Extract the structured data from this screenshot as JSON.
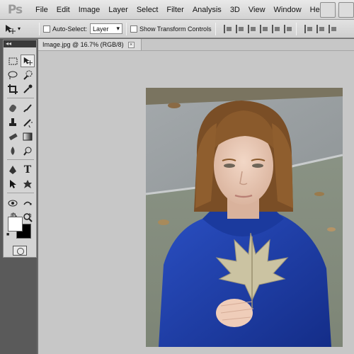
{
  "app": {
    "logo": "Ps"
  },
  "menu": {
    "items": [
      "File",
      "Edit",
      "Image",
      "Layer",
      "Select",
      "Filter",
      "Analysis",
      "3D",
      "View",
      "Window",
      "Help"
    ]
  },
  "options": {
    "auto_select_label": "Auto-Select:",
    "auto_select_value": "Layer",
    "transform_label": "Show Transform Controls"
  },
  "document": {
    "tab_title": "Image.jpg @ 16.7% (RGB/8)",
    "close_glyph": "×"
  },
  "toolbox": {
    "header": "◂◂",
    "foreground_color": "#ffffff",
    "background_color": "#000000"
  },
  "image": {
    "description_colors": {
      "sweater": "#1f3fa8",
      "hair": "#8a5a2c",
      "leaf": "#cdc4a3",
      "grass": "#8f9888",
      "pavement": "#9da3a6"
    }
  }
}
